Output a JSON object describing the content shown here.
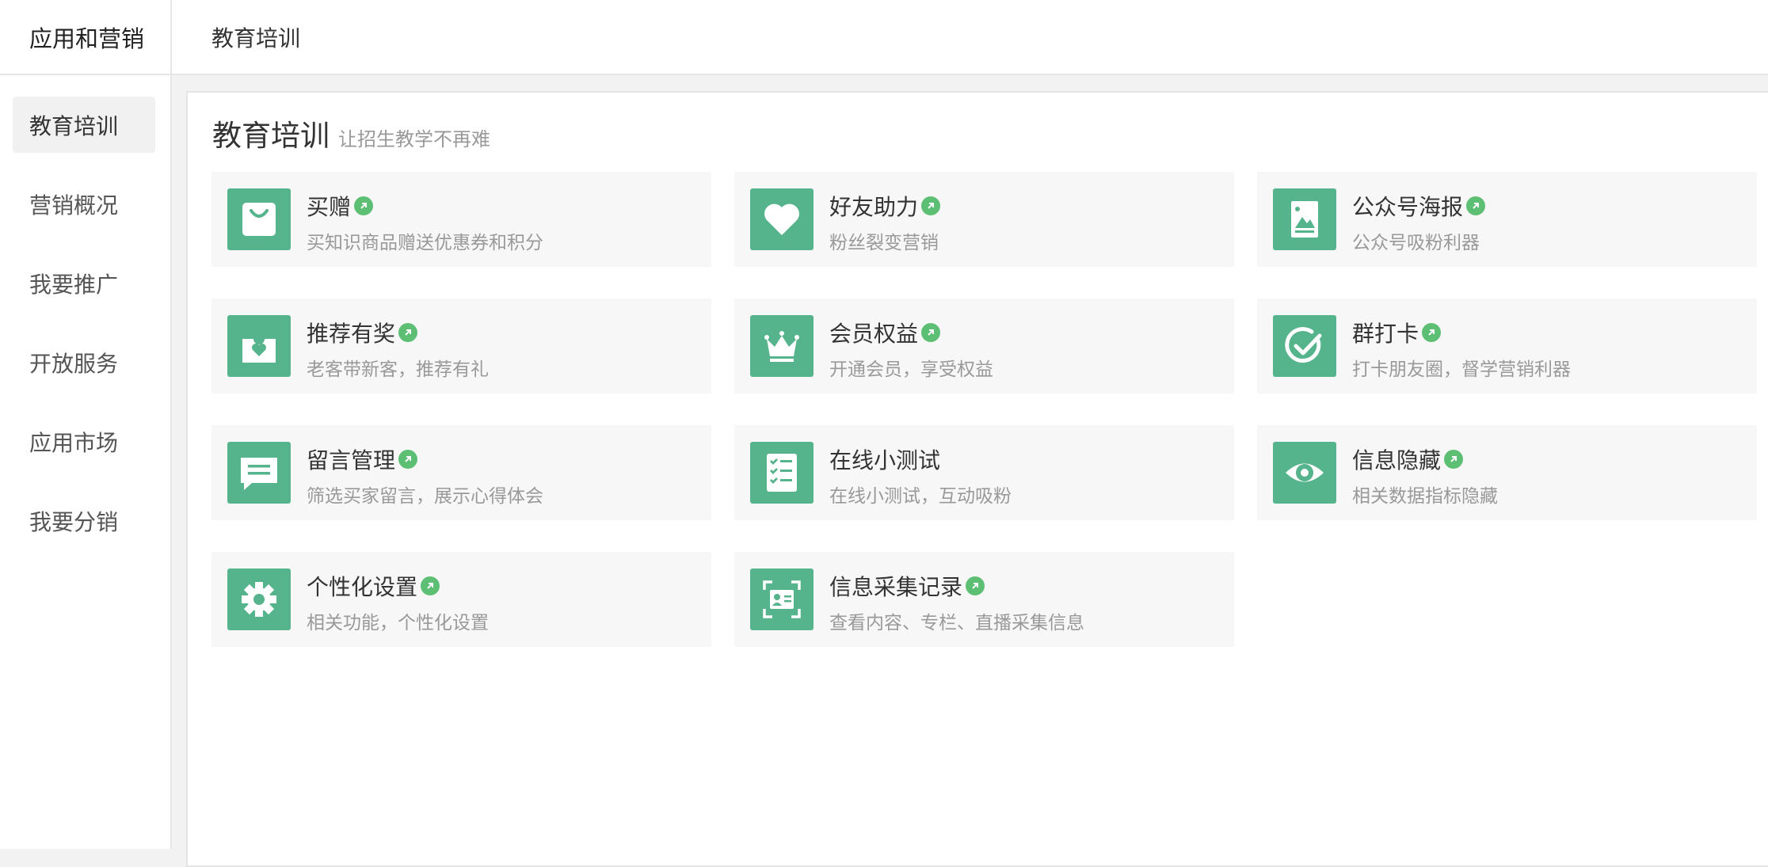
{
  "sidebar": {
    "header": "应用和营销",
    "items": [
      {
        "label": "教育培训",
        "active": true
      },
      {
        "label": "营销概况",
        "active": false
      },
      {
        "label": "我要推广",
        "active": false
      },
      {
        "label": "开放服务",
        "active": false
      },
      {
        "label": "应用市场",
        "active": false
      },
      {
        "label": "我要分销",
        "active": false
      }
    ]
  },
  "topbar": {
    "title": "教育培训"
  },
  "panel": {
    "title": "教育培训",
    "subtitle": "让招生教学不再难"
  },
  "colors": {
    "accent": "#55b48c",
    "badge": "#5cbf73"
  },
  "cards": [
    {
      "title": "买赠",
      "desc": "买知识商品赠送优惠券和积分",
      "icon": "shopping-bag-icon",
      "badge": true
    },
    {
      "title": "好友助力",
      "desc": "粉丝裂变营销",
      "icon": "heart-icon",
      "badge": true
    },
    {
      "title": "公众号海报",
      "desc": "公众号吸粉利器",
      "icon": "poster-icon",
      "badge": true
    },
    {
      "title": "推荐有奖",
      "desc": "老客带新客，推荐有礼",
      "icon": "gift-heart-icon",
      "badge": true
    },
    {
      "title": "会员权益",
      "desc": "开通会员，享受权益",
      "icon": "crown-icon",
      "badge": true
    },
    {
      "title": "群打卡",
      "desc": "打卡朋友圈，督学营销利器",
      "icon": "check-circle-icon",
      "badge": true
    },
    {
      "title": "留言管理",
      "desc": "筛选买家留言，展示心得体会",
      "icon": "message-icon",
      "badge": true
    },
    {
      "title": "在线小测试",
      "desc": "在线小测试，互动吸粉",
      "icon": "checklist-icon",
      "badge": false
    },
    {
      "title": "信息隐藏",
      "desc": "相关数据指标隐藏",
      "icon": "eye-icon",
      "badge": true
    },
    {
      "title": "个性化设置",
      "desc": "相关功能，个性化设置",
      "icon": "gear-icon",
      "badge": true
    },
    {
      "title": "信息采集记录",
      "desc": "查看内容、专栏、直播采集信息",
      "icon": "id-card-scan-icon",
      "badge": true
    }
  ]
}
